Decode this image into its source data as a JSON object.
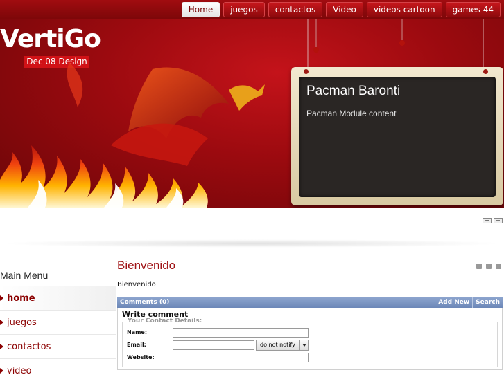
{
  "nav": {
    "items": [
      {
        "label": "Home",
        "active": true
      },
      {
        "label": "juegos",
        "active": false
      },
      {
        "label": "contactos",
        "active": false
      },
      {
        "label": "Video",
        "active": false
      },
      {
        "label": "videos cartoon",
        "active": false
      },
      {
        "label": "games 44",
        "active": false
      }
    ]
  },
  "brand": {
    "logo": "VertiGo",
    "subtitle": "Dec 08 Design"
  },
  "module": {
    "title": "Pacman Baronti",
    "text": "Pacman Module content"
  },
  "sidebar": {
    "title": "Main Menu",
    "items": [
      {
        "label": "home",
        "active": true
      },
      {
        "label": "juegos",
        "active": false
      },
      {
        "label": "contactos",
        "active": false
      },
      {
        "label": "video",
        "active": false
      }
    ]
  },
  "article": {
    "title": "Bienvenido",
    "body": "Bienvenido"
  },
  "comments": {
    "header": "Comments (0)",
    "add_new": "Add New",
    "search": "Search",
    "write_title": "Write comment",
    "legend": "Your Contact Details:",
    "fields": {
      "name_label": "Name:",
      "email_label": "Email:",
      "website_label": "Website:"
    },
    "notify_value": "do not notify"
  },
  "colors": {
    "brand_red": "#9b0a0f",
    "accent": "#a01417",
    "comments_bar": "#7a93c4"
  },
  "icons": [
    "pdf-icon",
    "print-icon",
    "email-icon",
    "slider-minus-icon",
    "slider-plus-icon"
  ]
}
